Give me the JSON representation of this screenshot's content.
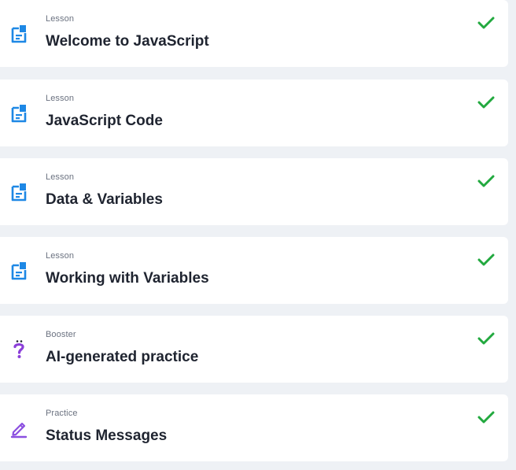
{
  "items": [
    {
      "type": "Lesson",
      "title": "Welcome to JavaScript",
      "icon": "lesson-doc-icon",
      "completed": true
    },
    {
      "type": "Lesson",
      "title": "JavaScript Code",
      "icon": "lesson-doc-icon",
      "completed": true
    },
    {
      "type": "Lesson",
      "title": "Data & Variables",
      "icon": "lesson-doc-icon",
      "completed": true
    },
    {
      "type": "Lesson",
      "title": "Working with Variables",
      "icon": "lesson-doc-icon",
      "completed": true
    },
    {
      "type": "Booster",
      "title": "AI-generated practice",
      "icon": "question-mark-icon",
      "completed": true
    },
    {
      "type": "Practice",
      "title": "Status Messages",
      "icon": "pencil-icon",
      "completed": true
    }
  ],
  "colors": {
    "background": "#eef1f5",
    "card": "#ffffff",
    "lesson_icon": "#1e88e5",
    "booster_icon": "#8b3fd9",
    "practice_icon": "#8b4fe0",
    "check": "#22a93f",
    "title": "#1f2430",
    "label": "#6b7280"
  }
}
